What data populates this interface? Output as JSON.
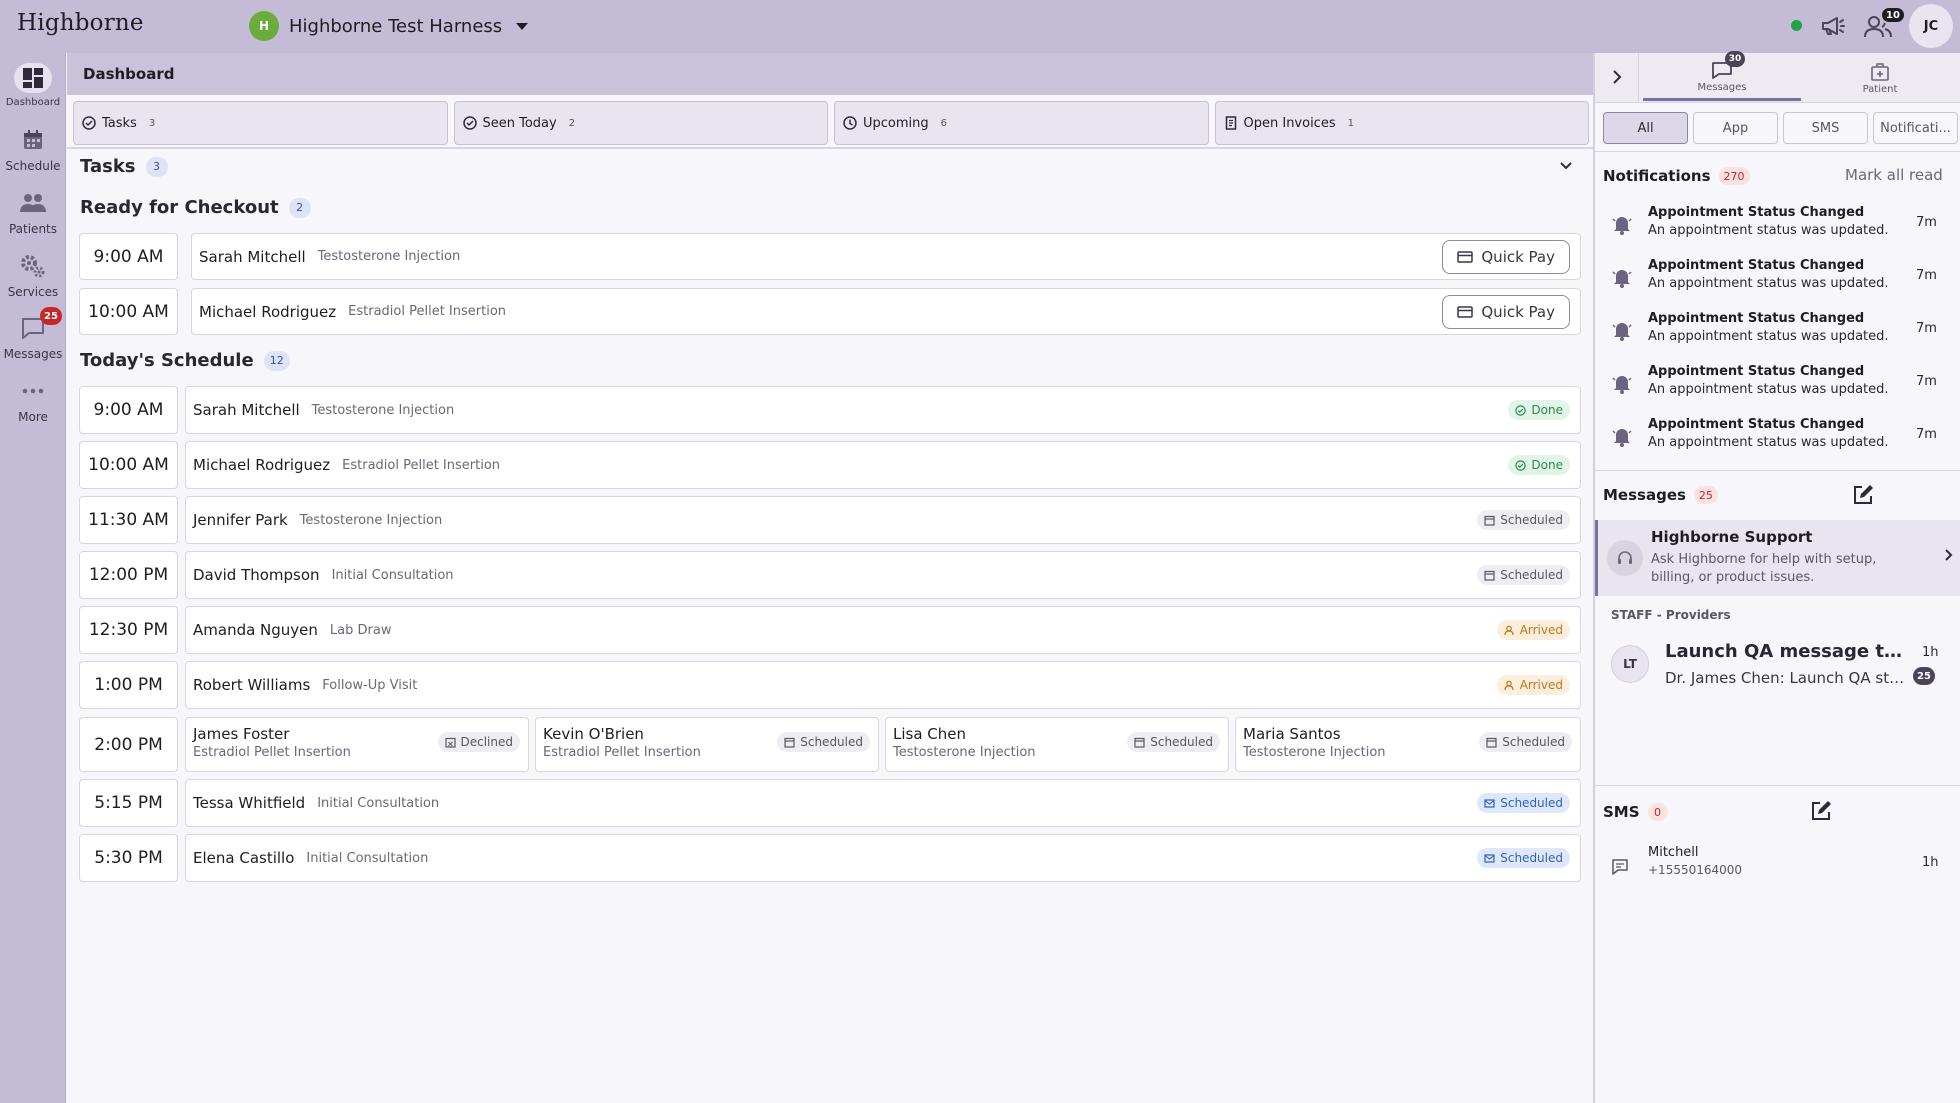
{
  "app": {
    "logo": "Highborne",
    "org_initial": "H",
    "org_name": "Highborne Test Harness",
    "status_color": "#22a04b",
    "users_badge": "10",
    "user_initials": "JC"
  },
  "nav": {
    "items": [
      {
        "label": "Dashboard",
        "icon": "dashboard-icon",
        "active": true
      },
      {
        "label": "Schedule",
        "icon": "calendar-icon"
      },
      {
        "label": "Patients",
        "icon": "patients-icon"
      },
      {
        "label": "Services",
        "icon": "gear-icon"
      },
      {
        "label": "Messages",
        "icon": "chat-icon",
        "badge": "25"
      },
      {
        "label": "More",
        "icon": "more-icon"
      }
    ]
  },
  "main": {
    "header": "Dashboard",
    "tabs": [
      {
        "label": "Tasks",
        "count": "3",
        "icon": "check-circle-icon"
      },
      {
        "label": "Seen Today",
        "count": "2",
        "icon": "check-circle-icon"
      },
      {
        "label": "Upcoming",
        "count": "6",
        "icon": "clock-icon"
      },
      {
        "label": "Open Invoices",
        "count": "1",
        "icon": "invoice-icon"
      }
    ],
    "tasks": {
      "title": "Tasks",
      "count": "3"
    },
    "checkout": {
      "title": "Ready for Checkout",
      "count": "2",
      "quick_pay_label": "Quick Pay",
      "rows": [
        {
          "time": "9:00 AM",
          "name": "Sarah Mitchell",
          "service": "Testosterone Injection"
        },
        {
          "time": "10:00 AM",
          "name": "Michael Rodriguez",
          "service": "Estradiol Pellet Insertion"
        }
      ]
    },
    "schedule": {
      "title": "Today's Schedule",
      "count": "12",
      "rows": [
        {
          "time": "9:00 AM",
          "name": "Sarah Mitchell",
          "service": "Testosterone Injection",
          "status": "Done",
          "kind": "done"
        },
        {
          "time": "10:00 AM",
          "name": "Michael Rodriguez",
          "service": "Estradiol Pellet Insertion",
          "status": "Done",
          "kind": "done"
        },
        {
          "time": "11:30 AM",
          "name": "Jennifer Park",
          "service": "Testosterone Injection",
          "status": "Scheduled",
          "kind": "scheduled"
        },
        {
          "time": "12:00 PM",
          "name": "David Thompson",
          "service": "Initial Consultation",
          "status": "Scheduled",
          "kind": "scheduled"
        },
        {
          "time": "12:30 PM",
          "name": "Amanda Nguyen",
          "service": "Lab Draw",
          "status": "Arrived",
          "kind": "arrived"
        },
        {
          "time": "1:00 PM",
          "name": "Robert Williams",
          "service": "Follow-Up Visit",
          "status": "Arrived",
          "kind": "arrived"
        }
      ],
      "multi": {
        "time": "2:00 PM",
        "items": [
          {
            "name": "James Foster",
            "service": "Estradiol Pellet Insertion",
            "status": "Declined",
            "kind": "declined"
          },
          {
            "name": "Kevin O'Brien",
            "service": "Estradiol Pellet Insertion",
            "status": "Scheduled",
            "kind": "scheduled"
          },
          {
            "name": "Lisa Chen",
            "service": "Testosterone Injection",
            "status": "Scheduled",
            "kind": "scheduled"
          },
          {
            "name": "Maria Santos",
            "service": "Testosterone Injection",
            "status": "Scheduled",
            "kind": "scheduled"
          }
        ]
      },
      "late_rows": [
        {
          "time": "5:15 PM",
          "name": "Tessa Whitfield",
          "service": "Initial Consultation",
          "status": "Scheduled",
          "kind": "scheduled-blue"
        },
        {
          "time": "5:30 PM",
          "name": "Elena Castillo",
          "service": "Initial Consultation",
          "status": "Scheduled",
          "kind": "scheduled-blue"
        }
      ]
    }
  },
  "panel": {
    "tabs": [
      {
        "label": "Messages",
        "badge": "30",
        "active": true
      },
      {
        "label": "Patient"
      }
    ],
    "filters": [
      "All",
      "App",
      "SMS",
      "Notificati..."
    ],
    "notifications": {
      "title": "Notifications",
      "count": "270",
      "mark_all": "Mark all read",
      "items": [
        {
          "title": "Appointment Status Changed",
          "desc": "An appointment status was updated.",
          "time": "7m"
        },
        {
          "title": "Appointment Status Changed",
          "desc": "An appointment status was updated.",
          "time": "7m"
        },
        {
          "title": "Appointment Status Changed",
          "desc": "An appointment status was updated.",
          "time": "7m"
        },
        {
          "title": "Appointment Status Changed",
          "desc": "An appointment status was updated.",
          "time": "7m"
        },
        {
          "title": "Appointment Status Changed",
          "desc": "An appointment status was updated.",
          "time": "7m"
        }
      ]
    },
    "messages": {
      "title": "Messages",
      "count": "25",
      "support_title": "Highborne Support",
      "support_desc": "Ask Highborne for help with setup, billing, or product issues.",
      "staff_label": "STAFF - Providers",
      "thread": {
        "initials": "LT",
        "title": "Launch QA message thread",
        "preview": "Dr. James Chen: Launch QA status update",
        "time": "1h",
        "badge": "25"
      }
    },
    "sms": {
      "title": "SMS",
      "count": "0",
      "item": {
        "name": "Mitchell",
        "phone": "+15550164000",
        "time": "1h"
      }
    }
  }
}
